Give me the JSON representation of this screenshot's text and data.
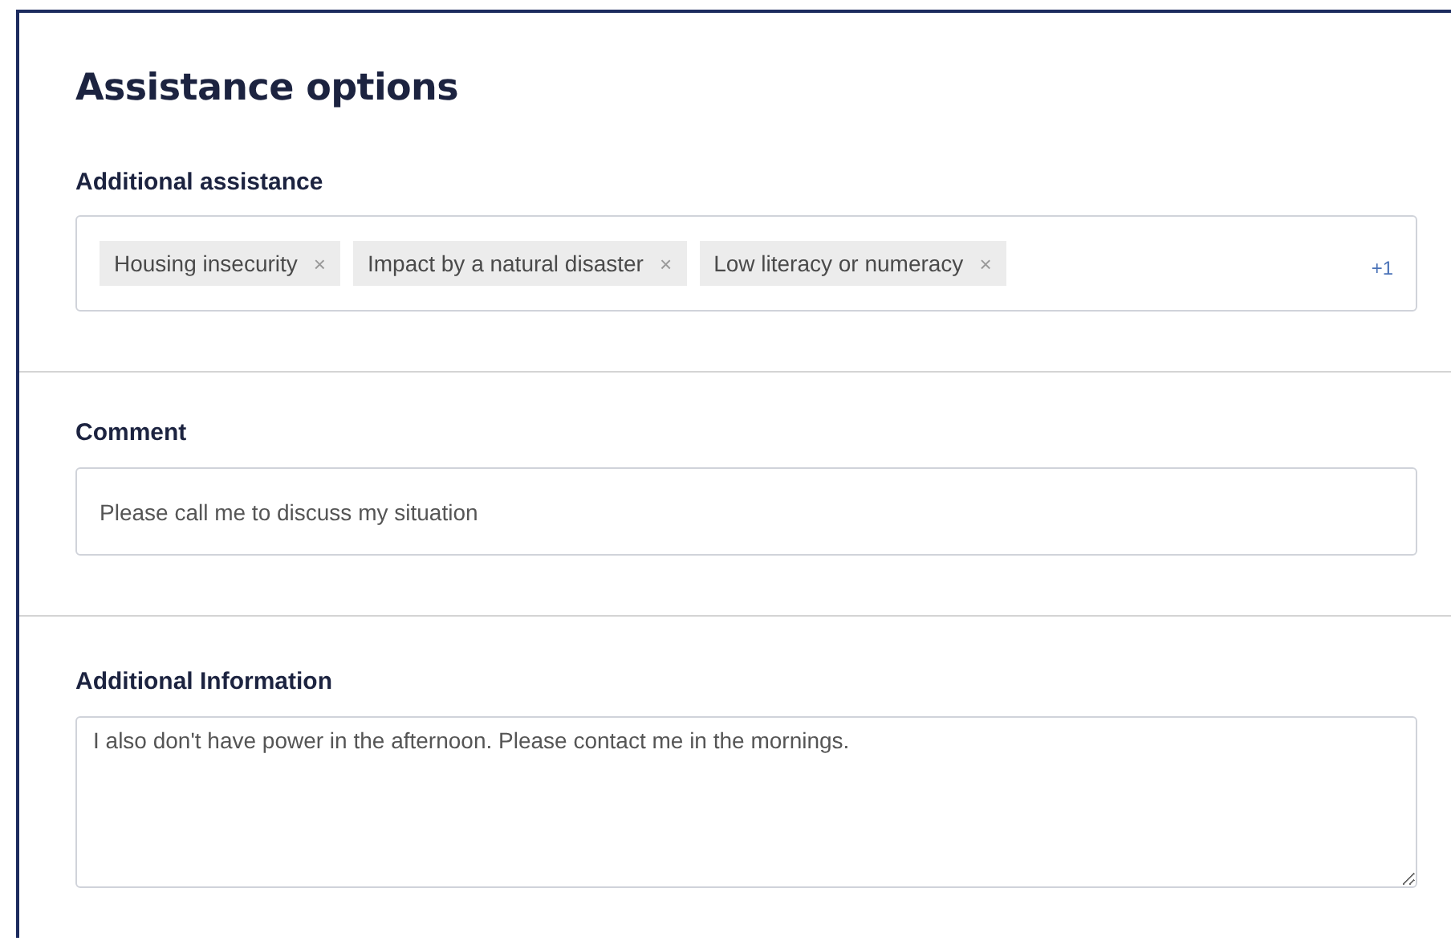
{
  "title": "Assistance options",
  "additional_assistance": {
    "label": "Additional assistance",
    "tags": [
      {
        "text": "Housing insecurity",
        "remove": "×"
      },
      {
        "text": "Impact by a natural disaster",
        "remove": "×"
      },
      {
        "text": "Low literacy or numeracy",
        "remove": "×"
      }
    ],
    "more_count": "+1"
  },
  "comment": {
    "label": "Comment",
    "value": "Please call me to discuss my situation"
  },
  "additional_information": {
    "label": "Additional Information",
    "value": "I also don't have power in the afternoon. Please contact me in the mornings."
  }
}
